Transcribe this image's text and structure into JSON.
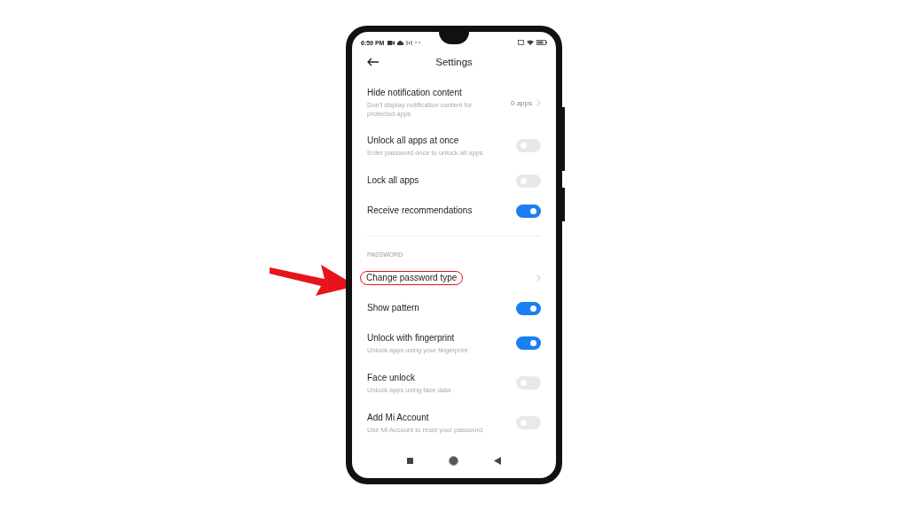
{
  "status_bar": {
    "time": "6:59 PM"
  },
  "header": {
    "title": "Settings"
  },
  "items": [
    {
      "kind": "link",
      "title": "Hide notification content",
      "subtitle": "Don't display notification content for protected apps",
      "value": "0 apps",
      "highlighted": false
    },
    {
      "kind": "toggle",
      "title": "Unlock all apps at once",
      "subtitle": "Enter password once to unlock all apps",
      "on": false
    },
    {
      "kind": "toggle",
      "title": "Lock all apps",
      "on": false
    },
    {
      "kind": "toggle",
      "title": "Receive recommendations",
      "on": true
    },
    {
      "kind": "divider"
    },
    {
      "kind": "section",
      "title": "PASSWORD"
    },
    {
      "kind": "link",
      "title": "Change password type",
      "highlighted": true
    },
    {
      "kind": "toggle",
      "title": "Show pattern",
      "on": true
    },
    {
      "kind": "toggle",
      "title": "Unlock with fingerprint",
      "subtitle": "Unlock apps using your fingerprint",
      "on": true
    },
    {
      "kind": "toggle",
      "title": "Face unlock",
      "subtitle": "Unlock apps using face data",
      "on": false
    },
    {
      "kind": "toggle",
      "title": "Add Mi Account",
      "subtitle": "Use Mi Account to reset your password",
      "on": false
    }
  ]
}
